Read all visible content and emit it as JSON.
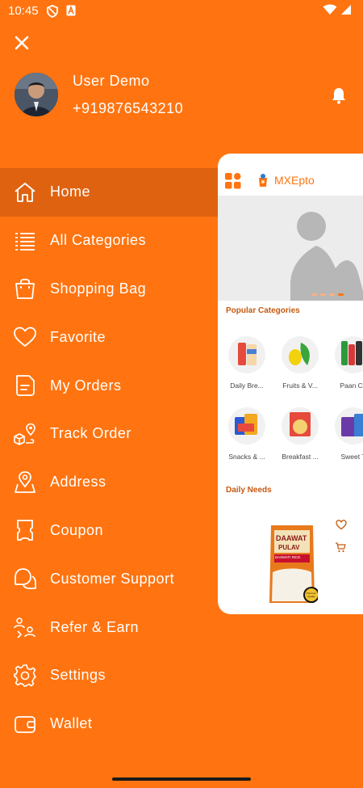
{
  "status_bar": {
    "time": "10:45",
    "left_icons": [
      "shield-icon",
      "a-icon"
    ],
    "right_icons": [
      "wifi-icon",
      "signal-icon"
    ]
  },
  "drawer": {
    "close_icon": "close-icon",
    "user": {
      "name": "User Demo",
      "phone": "+919876543210",
      "avatar": "avatar"
    },
    "notification_icon": "bell-icon",
    "menu": [
      {
        "label": "Home",
        "icon": "home-icon",
        "active": true
      },
      {
        "label": "All Categories",
        "icon": "categories-icon",
        "active": false
      },
      {
        "label": "Shopping Bag",
        "icon": "bag-icon",
        "active": false
      },
      {
        "label": "Favorite",
        "icon": "heart-icon",
        "active": false
      },
      {
        "label": "My Orders",
        "icon": "orders-icon",
        "active": false
      },
      {
        "label": "Track Order",
        "icon": "track-icon",
        "active": false
      },
      {
        "label": "Address",
        "icon": "location-icon",
        "active": false
      },
      {
        "label": "Coupon",
        "icon": "coupon-icon",
        "active": false
      },
      {
        "label": "Customer Support",
        "icon": "support-icon",
        "active": false
      },
      {
        "label": "Refer & Earn",
        "icon": "refer-icon",
        "active": false
      },
      {
        "label": "Settings",
        "icon": "settings-icon",
        "active": false
      },
      {
        "label": "Wallet",
        "icon": "wallet-icon",
        "active": false
      }
    ]
  },
  "preview": {
    "app_name": "MXEpto",
    "popular_title": "Popular Categories",
    "categories_row1": [
      "Daily Bre...",
      "Fruits & V...",
      "Paan Co"
    ],
    "categories_row2": [
      "Snacks & ...",
      "Breakfast ...",
      "Sweet T"
    ],
    "daily_title": "Daily Needs",
    "product_brand": "DAAWAT",
    "product_name": "PULAV",
    "product_sub": "BASMATI RICE",
    "badge": "Premium Quality"
  },
  "colors": {
    "primary": "#FF7410",
    "active_row": "#DF6210",
    "section_title": "#C55A10"
  }
}
